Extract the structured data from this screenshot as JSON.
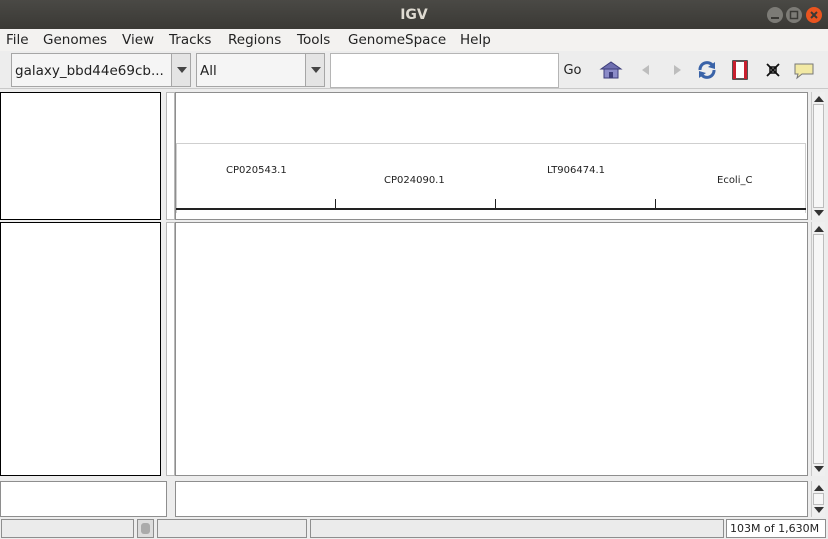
{
  "window": {
    "title": "IGV"
  },
  "menu": [
    "File",
    "Genomes",
    "View",
    "Tracks",
    "Regions",
    "Tools",
    "GenomeSpace",
    "Help"
  ],
  "toolbar": {
    "genome": "galaxy_bbd44e69cb...",
    "chromosome": "All",
    "locus_value": "",
    "go_label": "Go"
  },
  "ruler": {
    "sequences": [
      "CP020543.1",
      "CP024090.1",
      "LT906474.1",
      "Ecoli_C"
    ]
  },
  "status": {
    "memory": "103M of 1,630M"
  },
  "icons": {
    "home": "home-icon",
    "back": "back-arrow-icon",
    "forward": "forward-arrow-icon",
    "refresh": "refresh-icon",
    "roi": "region-of-interest-icon",
    "fit": "resize-to-window-icon",
    "popup": "popup-info-icon"
  }
}
